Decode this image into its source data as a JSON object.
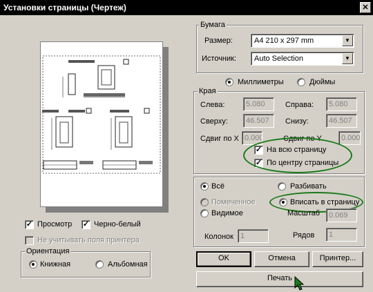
{
  "window": {
    "title": "Установки страницы (Чертеж)",
    "close_glyph": "✕"
  },
  "paper": {
    "group_title": "Бумага",
    "size_label": "Размер:",
    "size_value": "A4 210 x 297 mm",
    "source_label": "Источник:",
    "source_value": "Auto Selection"
  },
  "units": {
    "millimeters": "Миллиметры",
    "inches": "Дюймы",
    "selected": "millimeters"
  },
  "margins": {
    "group_title": "Края",
    "left_label": "Слева:",
    "left_value": "5.080",
    "right_label": "Справа:",
    "right_value": "5.080",
    "top_label": "Сверху:",
    "top_value": "46.507",
    "bottom_label": "Снизу:",
    "bottom_value": "46.507",
    "shift_x_label": "Сдвиг по X",
    "shift_x_value": "0.000",
    "shift_y_label": "Сдвиг по Y",
    "shift_y_value": "0.000",
    "fit_page_label": "На всю страницу",
    "fit_page_checked": true,
    "center_label": "По центру страницы",
    "center_checked": true
  },
  "range": {
    "all_label": "Всё",
    "all_selected": true,
    "split_label": "Разбивать",
    "selected_label": "Помеченное",
    "fit_label": "Вписать в страницу",
    "fit_selected": true,
    "visible_label": "Видимое",
    "scale_label": "Масштаб",
    "scale_value": "0.069",
    "columns_label": "Колонок",
    "columns_value": "1",
    "rows_label": "Рядов",
    "rows_value": "1"
  },
  "preview": {
    "preview_label": "Просмотр",
    "preview_checked": true,
    "bw_label": "Черно-белый",
    "bw_checked": true,
    "ignore_margins_label": "Не учитывать поля принтера"
  },
  "orientation": {
    "group_title": "Ориентация",
    "portrait": "Книжная",
    "landscape": "Альбомная",
    "selected": "portrait"
  },
  "buttons": {
    "ok": "OK",
    "cancel": "Отмена",
    "printer": "Принтер...",
    "print": "Печать"
  },
  "colors": {
    "annotation": "#1a7a1a",
    "face": "#d4d0c8"
  }
}
